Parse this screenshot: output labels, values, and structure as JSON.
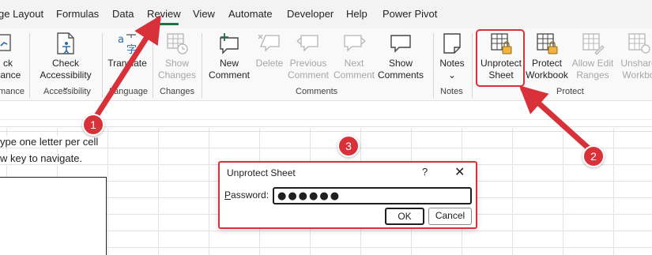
{
  "menu": {
    "tabs": [
      "ge Layout",
      "Formulas",
      "Data",
      "Review",
      "View",
      "Automate",
      "Developer",
      "Help",
      "Power Pivot"
    ],
    "active": "Review"
  },
  "ribbon": {
    "buttons": {
      "check_performance": [
        "ck",
        "nance"
      ],
      "check_accessibility": [
        "Check",
        "Accessibility ⌄"
      ],
      "translate": [
        "Translate"
      ],
      "show_changes": [
        "Show",
        "Changes"
      ],
      "new_comment": [
        "New",
        "Comment"
      ],
      "delete": [
        "Delete"
      ],
      "previous_comment": [
        "Previous",
        "Comment"
      ],
      "next_comment": [
        "Next",
        "Comment"
      ],
      "show_comments": [
        "Show",
        "Comments"
      ],
      "notes": [
        "Notes",
        "⌄"
      ],
      "unprotect_sheet": [
        "Unprotect",
        "Sheet"
      ],
      "protect_workbook": [
        "Protect",
        "Workbook"
      ],
      "allow_edit_ranges": [
        "Allow Edit",
        "Ranges"
      ],
      "unshare_workbook": [
        "Unshare",
        "Workbo"
      ]
    },
    "groups": {
      "performance": "mance",
      "accessibility": "Accessibility",
      "language": "Language",
      "changes": "Changes",
      "comments": "Comments",
      "notes": "Notes",
      "protect": "Protect"
    }
  },
  "sheet": {
    "line1": "ype one letter per cell",
    "line2": "w key to navigate."
  },
  "dialog": {
    "title": "Unprotect Sheet",
    "help": "?",
    "close": "✕",
    "password_label_first": "P",
    "password_label_rest": "assword:",
    "password_value": "●●●●●●",
    "ok": "OK",
    "cancel": "Cancel"
  },
  "annotations": {
    "badge1": "1",
    "badge2": "2",
    "badge3": "3"
  },
  "colors": {
    "accent_red": "#d9313a",
    "excel_green": "#1e7145"
  },
  "icons": {
    "check_accessibility": "accessibility-person-icon",
    "translate": "translate-icon",
    "show_changes": "changes-history-icon",
    "new_comment": "new-comment-icon",
    "delete": "delete-comment-icon",
    "previous": "previous-comment-icon",
    "next": "next-comment-icon",
    "show_comments": "comments-icon",
    "notes": "note-icon",
    "unprotect": "unprotect-sheet-icon",
    "protect_workbook": "protect-workbook-icon",
    "allow_edit": "allow-edit-ranges-icon",
    "unshare": "unshare-workbook-icon"
  }
}
